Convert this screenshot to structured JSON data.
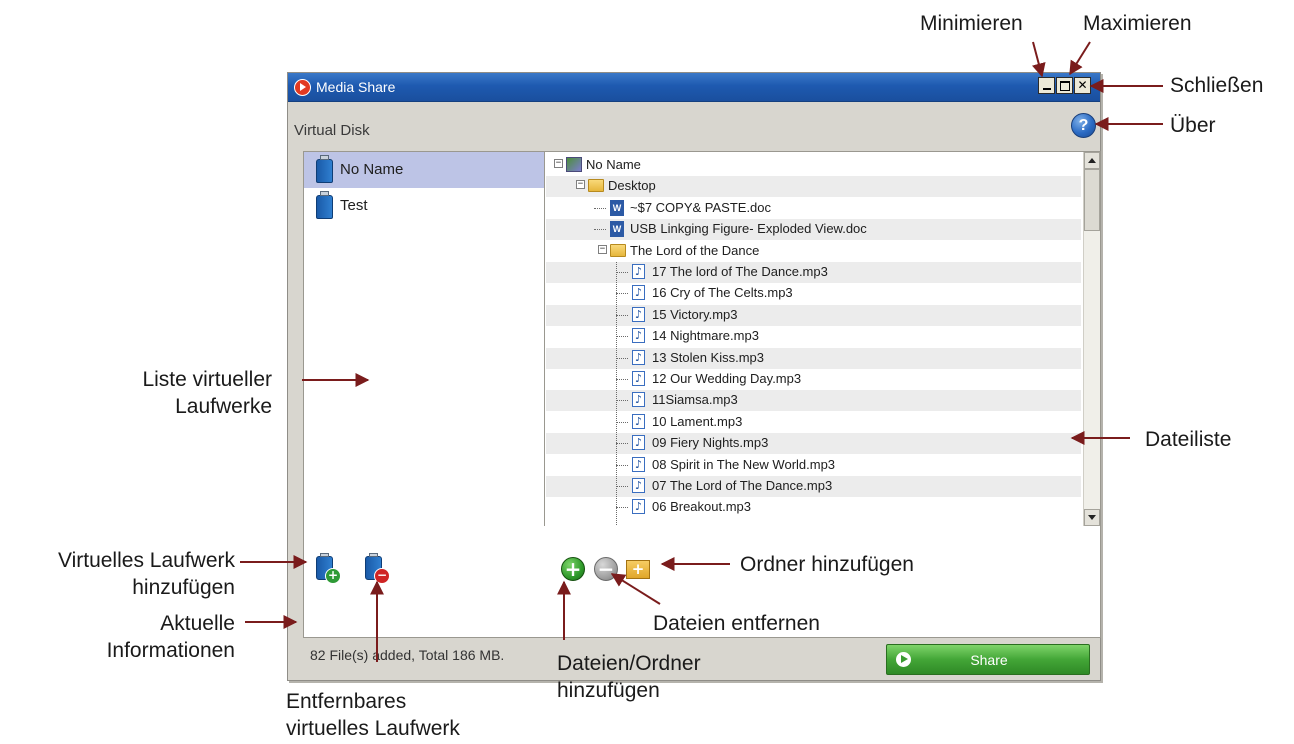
{
  "window": {
    "title": "Media Share",
    "section_label": "Virtual Disk",
    "help_glyph": "?",
    "minimize_glyph": "",
    "maximize_glyph": "",
    "close_glyph": "✕"
  },
  "drives": [
    {
      "label": "No Name",
      "selected": true
    },
    {
      "label": "Test",
      "selected": false
    }
  ],
  "file_tree": [
    {
      "label": "No Name",
      "type": "drive",
      "depth": 0,
      "expander": "−"
    },
    {
      "label": "Desktop",
      "type": "folder",
      "depth": 1,
      "expander": "−"
    },
    {
      "label": "~$7 COPY& PASTE.doc",
      "type": "doc",
      "depth": 2
    },
    {
      "label": "USB Linkging Figure- Exploded View.doc",
      "type": "doc",
      "depth": 2
    },
    {
      "label": "The Lord of the Dance",
      "type": "folder",
      "depth": 2,
      "expander": "−"
    },
    {
      "label": "17 The lord of The Dance.mp3",
      "type": "music",
      "depth": 3
    },
    {
      "label": "16 Cry of The Celts.mp3",
      "type": "music",
      "depth": 3
    },
    {
      "label": "15 Victory.mp3",
      "type": "music",
      "depth": 3
    },
    {
      "label": "14 Nightmare.mp3",
      "type": "music",
      "depth": 3
    },
    {
      "label": "13 Stolen Kiss.mp3",
      "type": "music",
      "depth": 3
    },
    {
      "label": "12 Our Wedding Day.mp3",
      "type": "music",
      "depth": 3
    },
    {
      "label": "11Siamsa.mp3",
      "type": "music",
      "depth": 3
    },
    {
      "label": "10 Lament.mp3",
      "type": "music",
      "depth": 3
    },
    {
      "label": "09 Fiery Nights.mp3",
      "type": "music",
      "depth": 3
    },
    {
      "label": "08 Spirit in The New World.mp3",
      "type": "music",
      "depth": 3
    },
    {
      "label": "07 The Lord of The Dance.mp3",
      "type": "music",
      "depth": 3
    },
    {
      "label": "06 Breakout.mp3",
      "type": "music",
      "depth": 3
    }
  ],
  "toolbar": {
    "add_drive_badge": "+",
    "remove_drive_badge": "−",
    "add_files_glyph": "+",
    "remove_files_glyph": "−",
    "add_folder_glyph": "+"
  },
  "status": {
    "text": "82 File(s) added, Total 186 MB."
  },
  "share_button": {
    "label": "Share"
  },
  "callouts": {
    "minimize": "Minimieren",
    "maximize": "Maximieren",
    "close": "Schließen",
    "about": "Über",
    "drive_list": [
      "Liste virtueller",
      "Laufwerke"
    ],
    "file_list": "Dateiliste",
    "add_drive": [
      "Virtuelles Laufwerk",
      "hinzufügen"
    ],
    "current_info": [
      "Aktuelle",
      "Informationen"
    ],
    "removable_drive": [
      "Entfernbares",
      "virtuelles Laufwerk"
    ],
    "add_folder": "Ordner hinzufügen",
    "remove_files": "Dateien entfernen",
    "add_files": [
      "Dateien/Ordner",
      "hinzufügen"
    ]
  },
  "colors": {
    "titlebar": "#1e5ab0",
    "selection": "#bdc4e6",
    "share_green": "#43a637",
    "arrow": "#7a1c1c"
  },
  "icons": {
    "app": "media-share-app-icon",
    "help": "help-icon",
    "drive": "usb-drive-icon",
    "folder": "folder-icon",
    "doc": "word-document-icon",
    "music": "music-note-icon"
  }
}
